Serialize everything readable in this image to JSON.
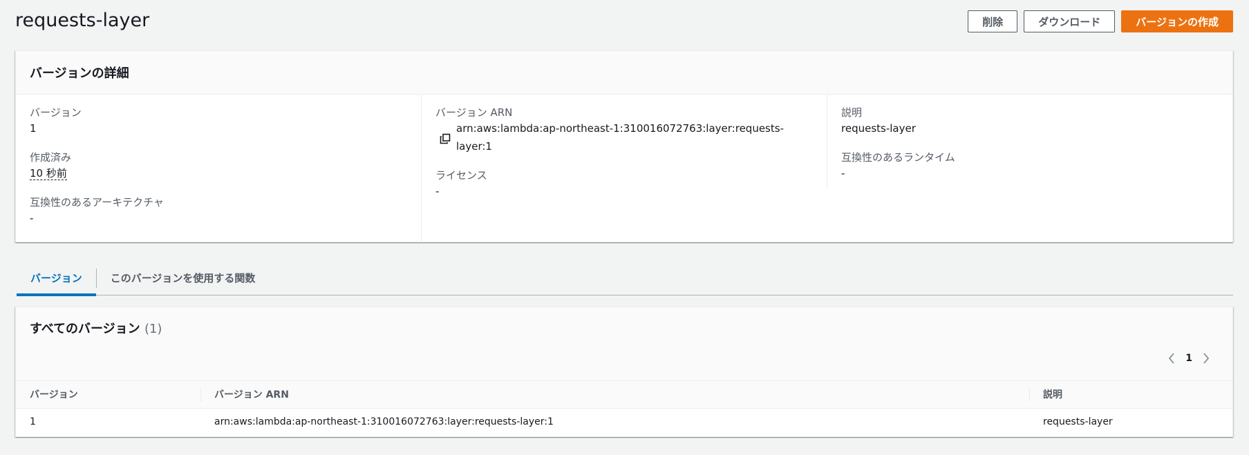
{
  "header": {
    "title": "requests-layer",
    "buttons": {
      "delete": "削除",
      "download": "ダウンロード",
      "create": "バージョンの作成"
    }
  },
  "details": {
    "title": "バージョンの詳細",
    "version_label": "バージョン",
    "version_value": "1",
    "created_label": "作成済み",
    "created_value": "10 秒前",
    "arch_label": "互換性のあるアーキテクチャ",
    "arch_value": "-",
    "arn_label": "バージョン ARN",
    "arn_value": "arn:aws:lambda:ap-northeast-1:310016072763:layer:requests-layer:1",
    "license_label": "ライセンス",
    "license_value": "-",
    "desc_label": "説明",
    "desc_value": "requests-layer",
    "runtime_label": "互換性のあるランタイム",
    "runtime_value": "-"
  },
  "tabs": {
    "versions": "バージョン",
    "functions": "このバージョンを使用する関数"
  },
  "versions_table": {
    "title": "すべてのバージョン",
    "count": "(1)",
    "page": "1",
    "columns": {
      "version": "バージョン",
      "arn": "バージョン ARN",
      "description": "説明"
    },
    "rows": [
      {
        "version": "1",
        "arn": "arn:aws:lambda:ap-northeast-1:310016072763:layer:requests-layer:1",
        "description": "requests-layer"
      }
    ]
  },
  "colors": {
    "primary": "#ec7211",
    "link": "#0073bb"
  }
}
